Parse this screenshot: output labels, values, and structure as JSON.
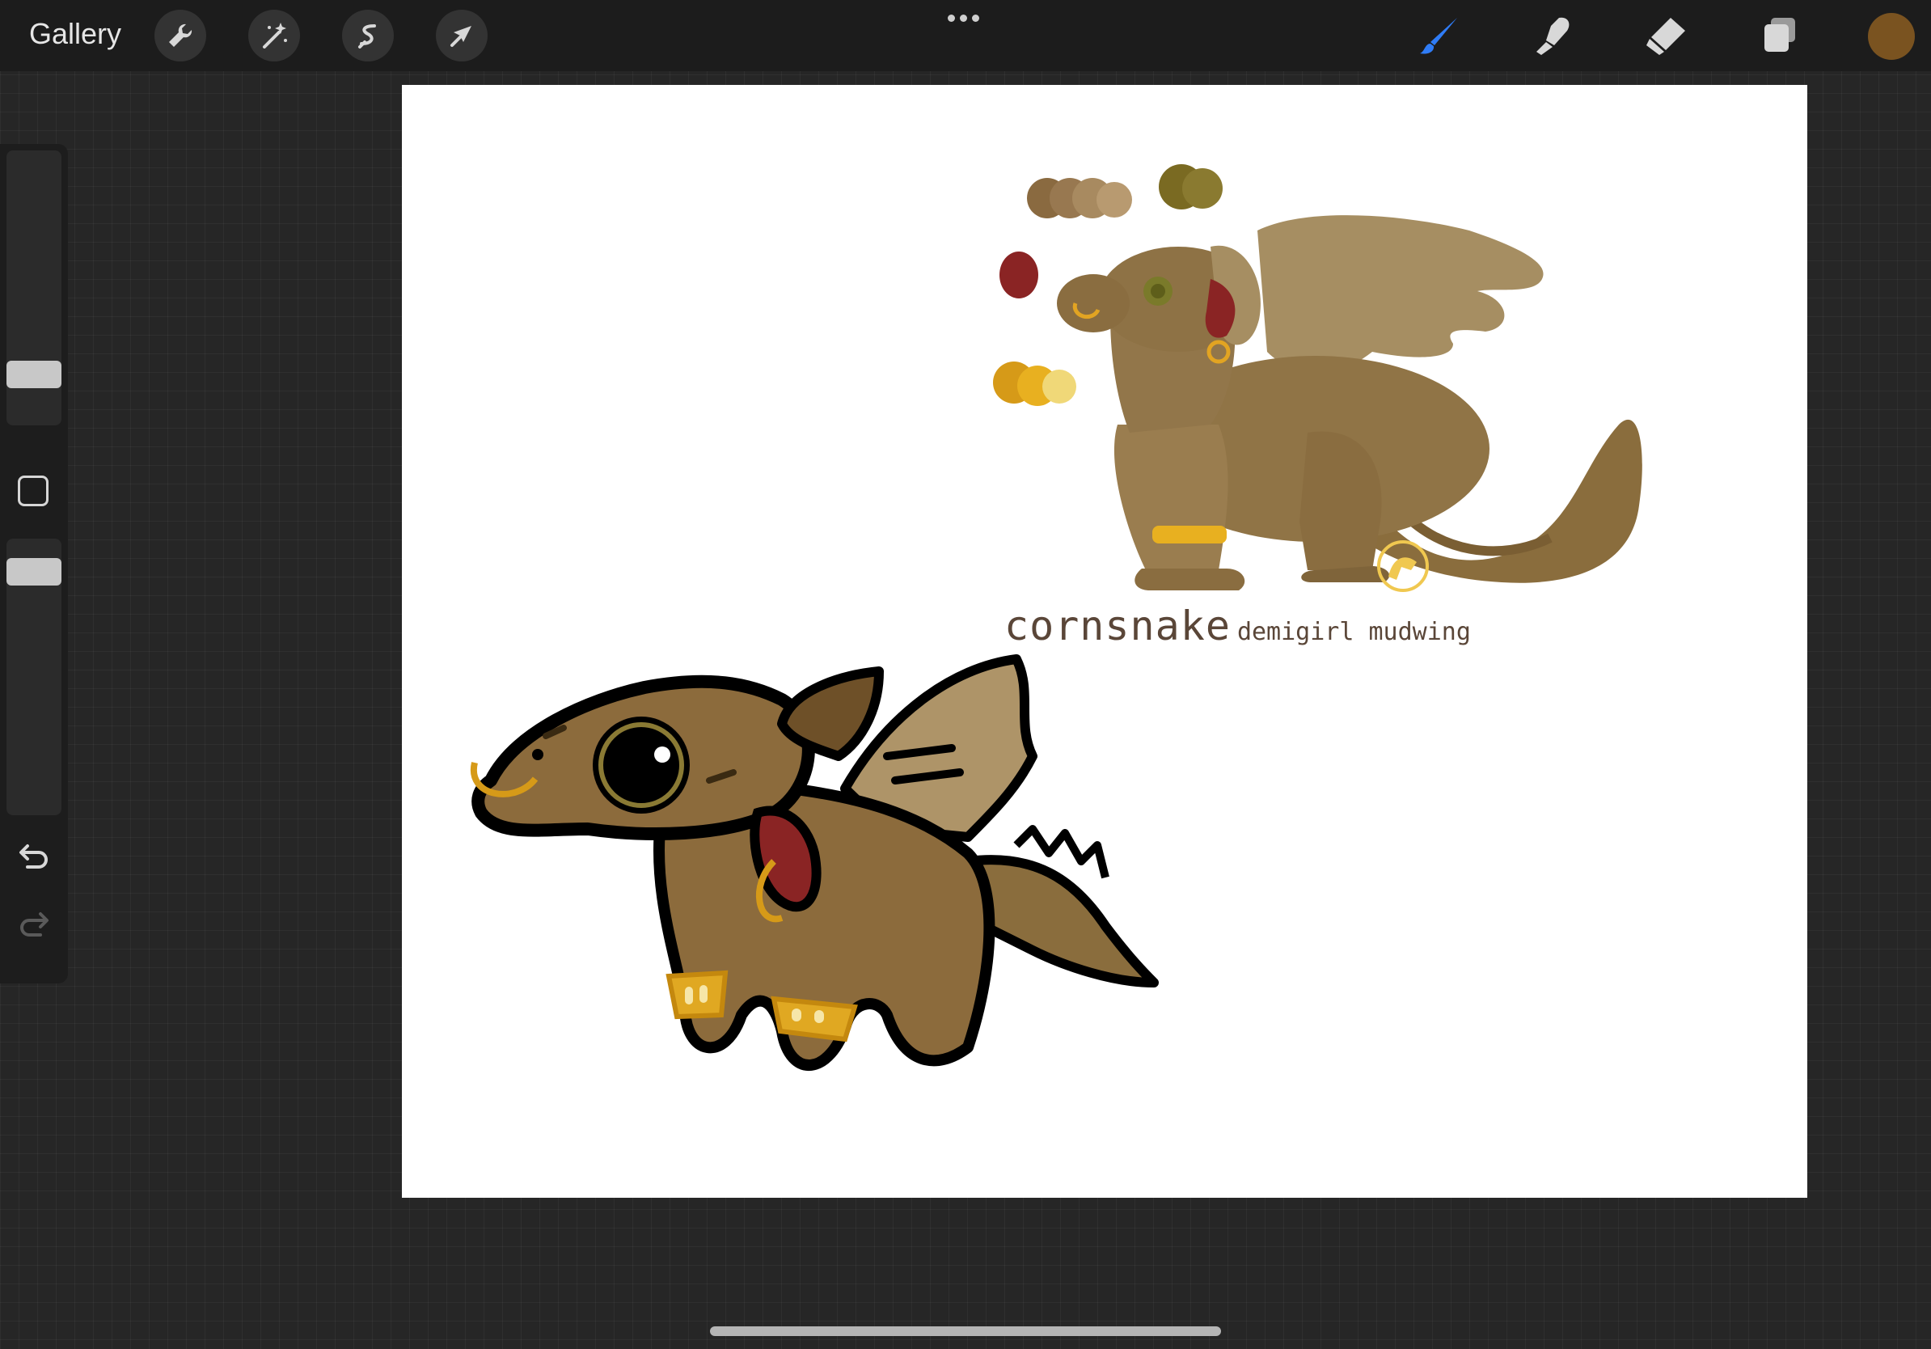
{
  "toolbar": {
    "gallery_label": "Gallery",
    "left_tools": [
      "wrench-icon",
      "magic-wand-icon",
      "selection-icon",
      "transform-arrow-icon"
    ],
    "more_menu": "ellipsis-icon",
    "right_tools": [
      "brush-icon",
      "smudge-icon",
      "eraser-icon",
      "layers-icon"
    ],
    "active_tool": "brush",
    "active_tool_color": "#2f7cf6",
    "current_color": "#7a5320"
  },
  "sidebar": {
    "brush_size_slider": "slider",
    "modify_button": "square-icon",
    "opacity_slider": "slider",
    "undo": "undo-icon",
    "redo": "redo-icon"
  },
  "canvas": {
    "background": "#ffffff",
    "title_big": "cornsnake",
    "title_small": "demigirl mudwing",
    "palette": {
      "browns": [
        "#8a6a40",
        "#987850",
        "#a88a60",
        "#b89a70"
      ],
      "olives": [
        "#7a6a22",
        "#8a7a30"
      ],
      "red": "#8a2424",
      "golds": [
        "#d69a18",
        "#e8b020",
        "#f0d878"
      ]
    }
  }
}
